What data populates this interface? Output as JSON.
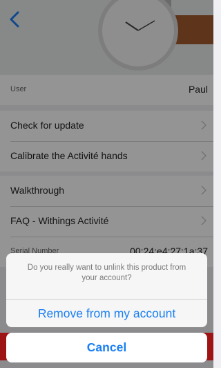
{
  "header": {
    "back_icon": "chevron-left-icon",
    "accent": "#1a7ff2"
  },
  "user_row": {
    "label": "User",
    "value": "Paul"
  },
  "rows_group1": [
    {
      "label": "Check for update"
    },
    {
      "label": "Calibrate the Activité hands"
    }
  ],
  "rows_group2": [
    {
      "label": "Walkthrough"
    },
    {
      "label": "FAQ - Withings Activité"
    }
  ],
  "serial_row": {
    "label": "Serial Number",
    "value": "00:24:e4:27:1a:37"
  },
  "action_sheet": {
    "message": "Do you really want to unlink this product from your account?",
    "remove_label": "Remove from my account",
    "cancel_label": "Cancel"
  }
}
